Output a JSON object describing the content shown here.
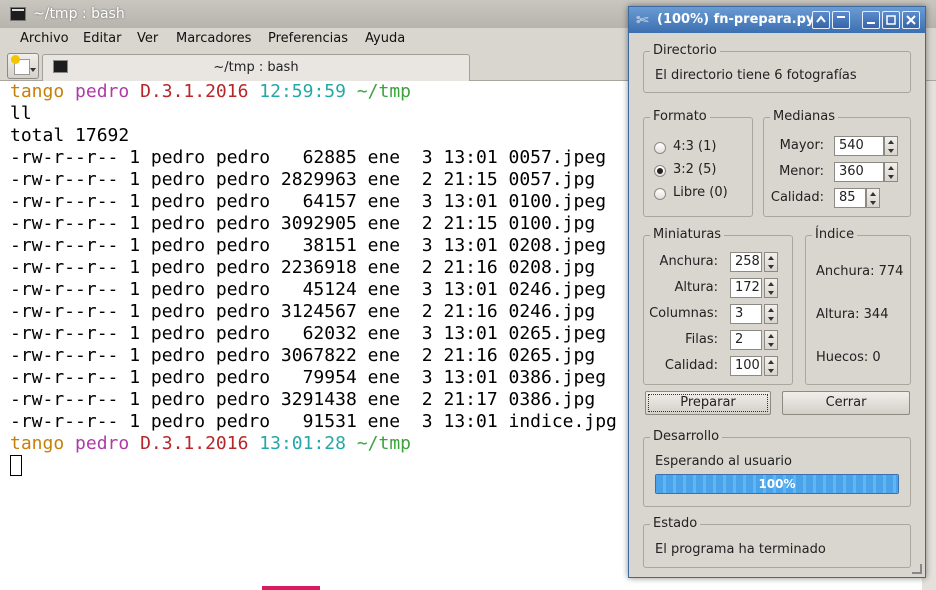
{
  "terminal_window": {
    "title": "~/tmp : bash",
    "menu": [
      "Archivo",
      "Editar",
      "Ver",
      "Marcadores",
      "Preferencias",
      "Ayuda"
    ],
    "tab_label": "~/tmp : bash"
  },
  "terminal": {
    "prompt1": {
      "host": "tango",
      "user": "pedro",
      "version": "D.3.1.2016",
      "time": "12:59:59",
      "dir": "~/tmp"
    },
    "command": "ll",
    "total": "total 17692",
    "files": [
      "-rw-r--r-- 1 pedro pedro   62885 ene  3 13:01 0057.jpeg",
      "-rw-r--r-- 1 pedro pedro 2829963 ene  2 21:15 0057.jpg",
      "-rw-r--r-- 1 pedro pedro   64157 ene  3 13:01 0100.jpeg",
      "-rw-r--r-- 1 pedro pedro 3092905 ene  2 21:15 0100.jpg",
      "-rw-r--r-- 1 pedro pedro   38151 ene  3 13:01 0208.jpeg",
      "-rw-r--r-- 1 pedro pedro 2236918 ene  2 21:16 0208.jpg",
      "-rw-r--r-- 1 pedro pedro   45124 ene  3 13:01 0246.jpeg",
      "-rw-r--r-- 1 pedro pedro 3124567 ene  2 21:16 0246.jpg",
      "-rw-r--r-- 1 pedro pedro   62032 ene  3 13:01 0265.jpeg",
      "-rw-r--r-- 1 pedro pedro 3067822 ene  2 21:16 0265.jpg",
      "-rw-r--r-- 1 pedro pedro   79954 ene  3 13:01 0386.jpeg",
      "-rw-r--r-- 1 pedro pedro 3291438 ene  2 21:17 0386.jpg",
      "-rw-r--r-- 1 pedro pedro   91531 ene  3 13:01 indice.jpg"
    ],
    "prompt2": {
      "host": "tango",
      "user": "pedro",
      "version": "D.3.1.2016",
      "time": "13:01:28",
      "dir": "~/tmp"
    }
  },
  "dialog": {
    "title": "(100%) fn-prepara.py",
    "directorio": {
      "title": "Directorio",
      "text": "El directorio tiene 6 fotografías"
    },
    "formato": {
      "title": "Formato",
      "options": [
        {
          "label": "4:3 (1)",
          "checked": false
        },
        {
          "label": "3:2 (5)",
          "checked": true
        },
        {
          "label": "Libre (0)",
          "checked": false
        }
      ]
    },
    "medianas": {
      "title": "Medianas",
      "fields": [
        {
          "label": "Mayor:",
          "value": "540"
        },
        {
          "label": "Menor:",
          "value": "360"
        },
        {
          "label": "Calidad:",
          "value": "85"
        }
      ]
    },
    "miniaturas": {
      "title": "Miniaturas",
      "fields": [
        {
          "label": "Anchura:",
          "value": "258"
        },
        {
          "label": "Altura:",
          "value": "172"
        },
        {
          "label": "Columnas:",
          "value": "3"
        },
        {
          "label": "Filas:",
          "value": "2"
        },
        {
          "label": "Calidad:",
          "value": "100"
        }
      ]
    },
    "indice": {
      "title": "Índice",
      "anchura": "Anchura: 774",
      "altura": "Altura: 344",
      "huecos": "Huecos: 0"
    },
    "buttons": {
      "prepare": "Preparar",
      "close": "Cerrar"
    },
    "desarrollo": {
      "title": "Desarrollo",
      "status": "Esperando al usuario",
      "progress_text": "100%",
      "progress": 1.0
    },
    "estado": {
      "title": "Estado",
      "text": "El programa ha terminado"
    }
  }
}
